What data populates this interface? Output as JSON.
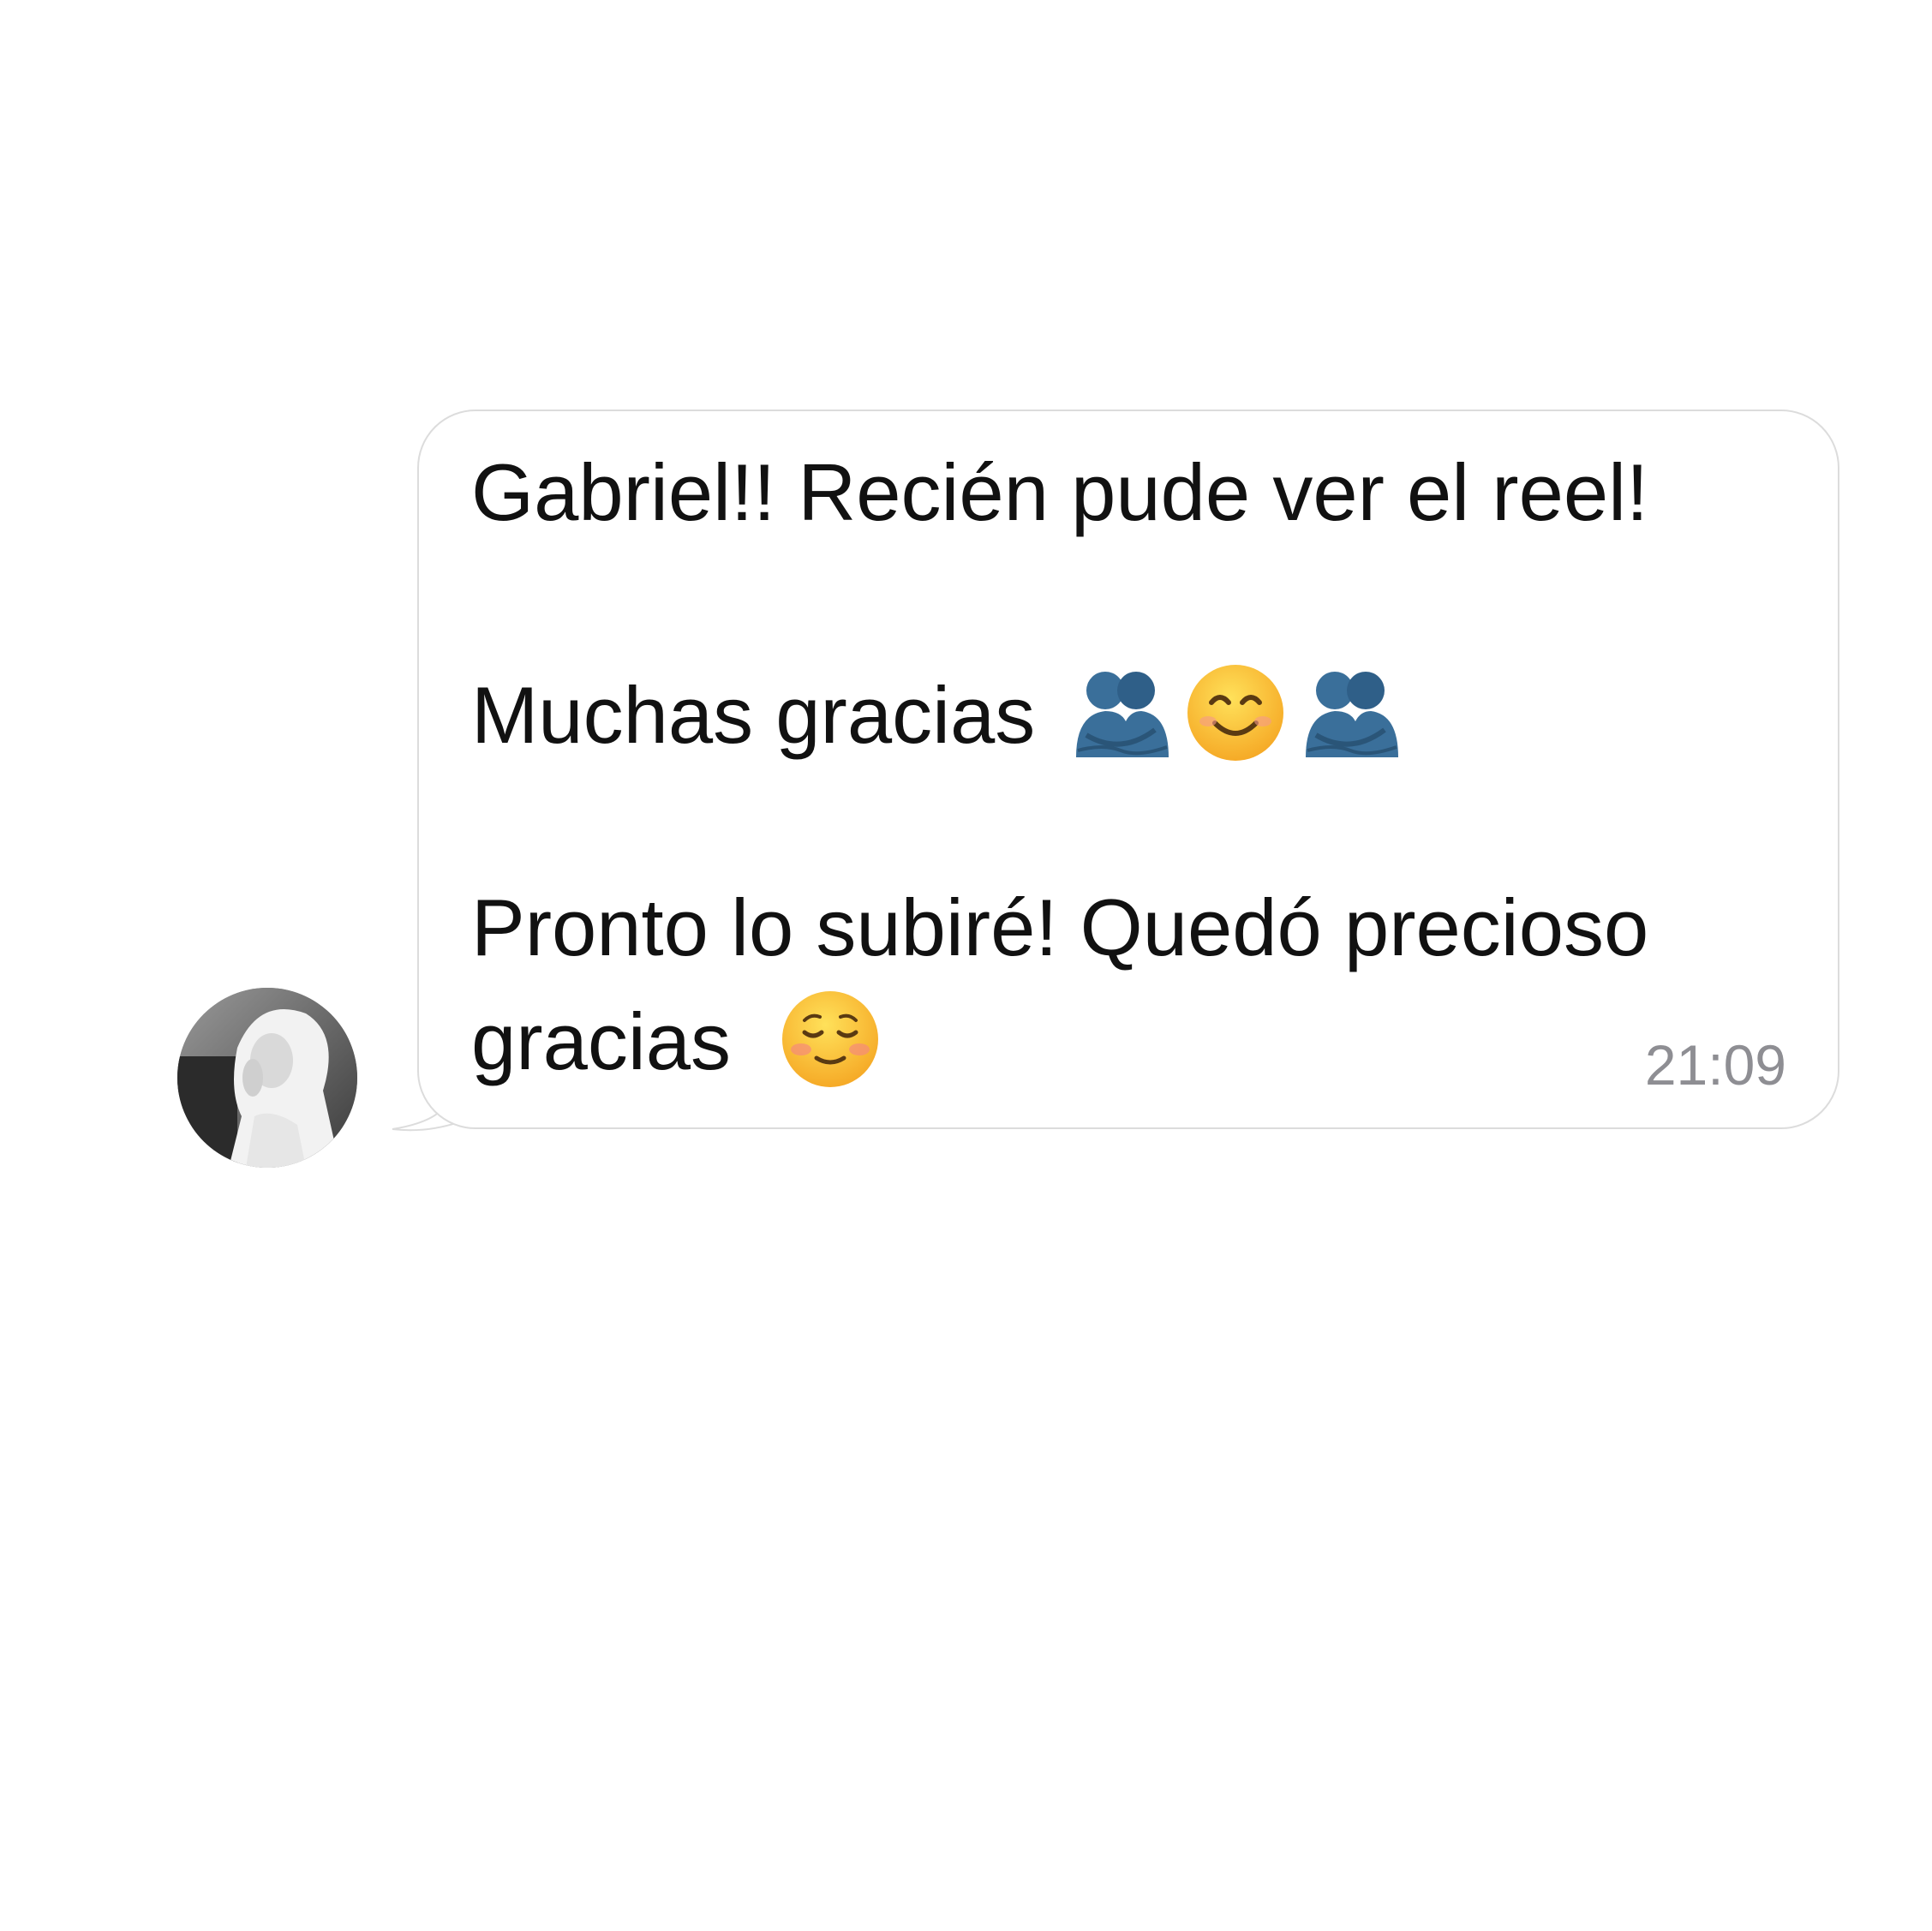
{
  "conversation": {
    "message": {
      "lines": [
        "Gabriel!! Recién pude ver el reel!",
        "Muchas gracias",
        "Pronto lo subiré! Quedó precioso",
        "gracias"
      ],
      "timestamp": "21:09",
      "emojis": {
        "line2": [
          "people-hugging-emoji",
          "smiling-face-with-smiling-eyes-emoji",
          "people-hugging-emoji"
        ],
        "line4": [
          "smiling-face-emoji"
        ]
      }
    },
    "sender": {
      "avatar_icon": "avatar-photo"
    },
    "colors": {
      "bubble_bg": "#ffffff",
      "bubble_border": "#dcdcdc",
      "text": "#111111",
      "timestamp": "#8e8e93",
      "hug_emoji": "#3a6f9a",
      "smile_emoji": "#f7c12b"
    }
  }
}
